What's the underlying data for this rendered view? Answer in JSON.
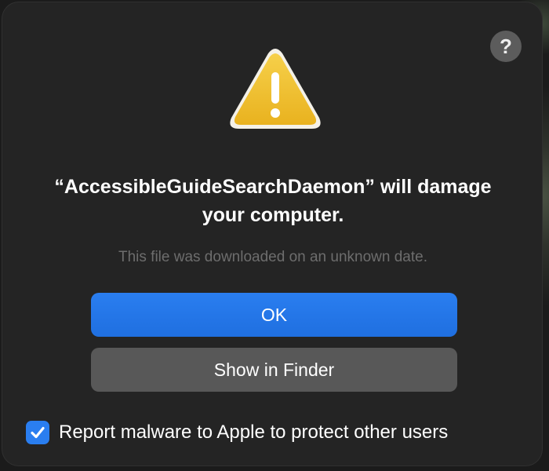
{
  "dialog": {
    "help_label": "?",
    "title": "“AccessibleGuideSearchDaemon” will damage your computer.",
    "subtitle": "This file was downloaded on an unknown date.",
    "icon": "warning-triangle-icon",
    "buttons": {
      "ok_label": "OK",
      "show_in_finder_label": "Show in Finder"
    },
    "report_checkbox": {
      "label": "Report malware to Apple to protect other users",
      "checked": true
    }
  },
  "colors": {
    "accent": "#2a7ef0",
    "warning": "#f2c230",
    "dialog_bg": "#242424",
    "secondary_button": "#585858"
  }
}
